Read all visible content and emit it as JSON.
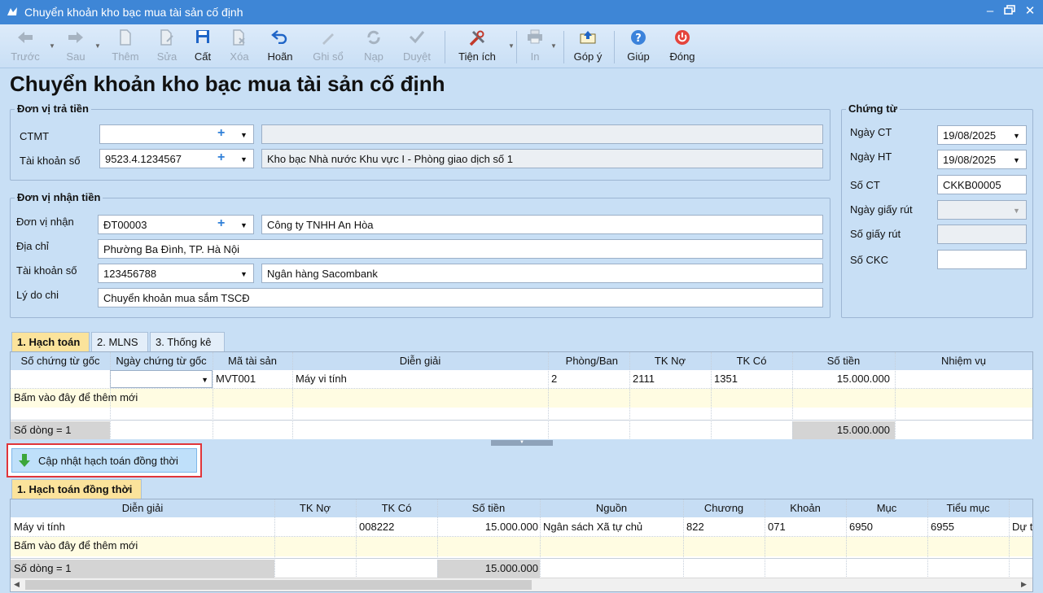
{
  "window": {
    "title": "Chuyển khoản kho bạc mua tài sản cố định"
  },
  "toolbar": {
    "prev": "Trước",
    "next": "Sau",
    "add": "Thêm",
    "edit": "Sửa",
    "save": "Cất",
    "delete": "Xóa",
    "undo": "Hoãn",
    "post": "Ghi sổ",
    "reload": "Nạp",
    "approve": "Duyệt",
    "utilities": "Tiện ích",
    "print": "In",
    "feedback": "Góp ý",
    "help": "Giúp",
    "close": "Đóng"
  },
  "page_title": "Chuyển khoản kho bạc mua tài sản cố định",
  "payer": {
    "group_title": "Đơn vị trả tiền",
    "ctmt_label": "CTMT",
    "ctmt_value": "",
    "ctmt_desc": "",
    "account_label": "Tài khoản số",
    "account_value": "9523.4.1234567",
    "account_desc": "Kho bạc Nhà nước Khu vực I - Phòng giao dịch số 1"
  },
  "payee": {
    "group_title": "Đơn vị nhận tiền",
    "unit_label": "Đơn vị nhận",
    "unit_value": "ĐT00003",
    "unit_name": "Công ty TNHH An Hòa",
    "address_label": "Địa chỉ",
    "address_value": "Phường Ba Đình, TP. Hà Nội",
    "account_label": "Tài khoản số",
    "account_value": "123456788",
    "bank_name": "Ngân hàng Sacombank",
    "reason_label": "Lý do chi",
    "reason_value": "Chuyển khoản mua sắm TSCĐ"
  },
  "voucher": {
    "group_title": "Chứng từ",
    "date_ct_label": "Ngày CT",
    "date_ct_value": "19/08/2025",
    "date_ht_label": "Ngày HT",
    "date_ht_value": "19/08/2025",
    "so_ct_label": "Số CT",
    "so_ct_value": "CKKB00005",
    "withdraw_date_label": "Ngày giấy rút",
    "withdraw_no_label": "Số giấy rút",
    "ckc_label": "Số CKC"
  },
  "tabs": [
    "1. Hạch toán",
    "2. MLNS",
    "3. Thống kê"
  ],
  "grid1": {
    "columns": [
      "Số chứng từ gốc",
      "Ngày chứng từ gốc",
      "Mã tài sản",
      "Diễn giải",
      "Phòng/Ban",
      "TK Nợ",
      "TK Có",
      "Số tiền",
      "Nhiệm vụ"
    ],
    "row": {
      "asset": "MVT001",
      "desc": "Máy vi tính",
      "dept": "2",
      "debit": "2111",
      "credit": "1351",
      "amount": "15.000.000"
    },
    "add_row": "Bấm vào đây để thêm mới",
    "count": "Số dòng = 1",
    "total": "15.000.000"
  },
  "update_button": "Cập nhật hạch toán đồng thời",
  "tab2": "1. Hạch toán đồng thời",
  "grid2": {
    "columns": [
      "Diễn giải",
      "TK Nợ",
      "TK Có",
      "Số tiền",
      "Nguồn",
      "Chương",
      "Khoản",
      "Mục",
      "Tiểu mục"
    ],
    "row": {
      "desc": "Máy vi tính",
      "debit": "",
      "credit": "008222",
      "amount": "15.000.000",
      "source": "Ngân sách Xã tự chủ",
      "chapter": "822",
      "item": "071",
      "section": "6950",
      "subsection": "6955",
      "extra": "Dự t"
    },
    "add_row": "Bấm vào đây để thêm mới",
    "count": "Số dòng = 1",
    "total": "15.000.000"
  }
}
